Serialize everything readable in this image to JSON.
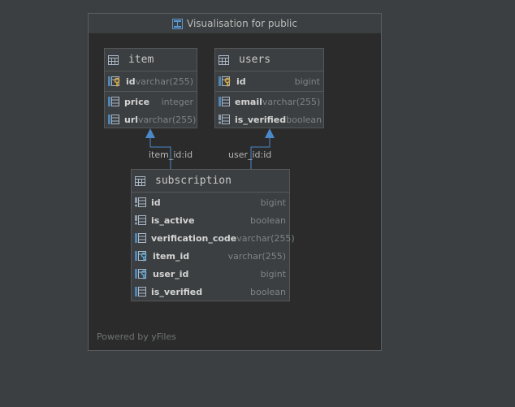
{
  "window": {
    "title": "Visualisation for public",
    "footer": "Powered by yFiles"
  },
  "colors": {
    "accent": "#4a88c7",
    "key_gold": "#d8a73a",
    "panel": "#2b2b2b"
  },
  "tables": {
    "item": {
      "name": "item",
      "sections": [
        [
          {
            "name": "id",
            "type": "varchar(255)",
            "icon": "primary-key-icon"
          }
        ],
        [
          {
            "name": "price",
            "type": "integer",
            "icon": "column-icon"
          },
          {
            "name": "url",
            "type": "varchar(255)",
            "icon": "column-icon"
          }
        ]
      ]
    },
    "users": {
      "name": "users",
      "sections": [
        [
          {
            "name": "id",
            "type": "bigint",
            "icon": "primary-key-icon"
          }
        ],
        [
          {
            "name": "email",
            "type": "varchar(255)",
            "icon": "column-icon"
          },
          {
            "name": "is_verified",
            "type": "boolean",
            "icon": "column-notnull-icon"
          }
        ]
      ]
    },
    "subscription": {
      "name": "subscription",
      "sections": [
        [
          {
            "name": "id",
            "type": "bigint",
            "icon": "column-notnull-icon"
          },
          {
            "name": "is_active",
            "type": "boolean",
            "icon": "column-notnull-icon"
          },
          {
            "name": "verification_code",
            "type": "varchar(255)",
            "icon": "column-icon"
          },
          {
            "name": "item_id",
            "type": "varchar(255)",
            "icon": "foreign-key-icon"
          },
          {
            "name": "user_id",
            "type": "bigint",
            "icon": "foreign-key-icon"
          },
          {
            "name": "is_verified",
            "type": "boolean",
            "icon": "column-icon"
          }
        ]
      ]
    }
  },
  "edges": [
    {
      "from": "subscription",
      "to": "item",
      "label": "item_id:id"
    },
    {
      "from": "subscription",
      "to": "users",
      "label": "user_id:id"
    }
  ]
}
